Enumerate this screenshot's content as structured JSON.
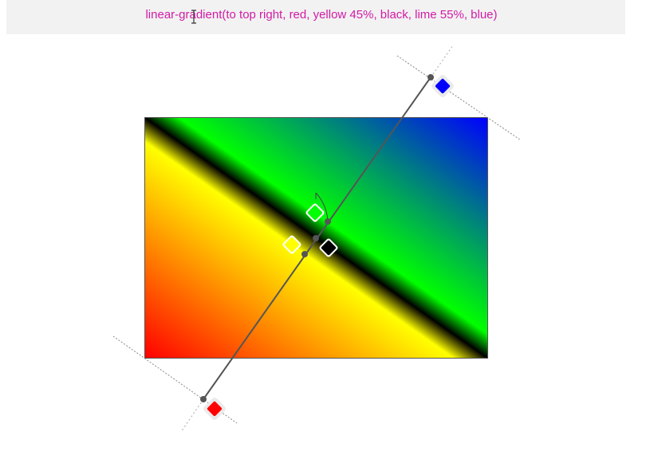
{
  "editor": {
    "css_value": "linear-gradient(to top right, red, yellow 45%, black, lime 55%, blue)"
  },
  "gradient": {
    "direction": "to top right",
    "stops": [
      {
        "color": "#ff0000",
        "name": "red",
        "position": null
      },
      {
        "color": "#ffff00",
        "name": "yellow",
        "position": 45
      },
      {
        "color": "#000000",
        "name": "black",
        "position": null
      },
      {
        "color": "#00ff00",
        "name": "lime",
        "position": 55
      },
      {
        "color": "#0000ff",
        "name": "blue",
        "position": null
      }
    ]
  },
  "colors": {
    "css_text": "#d11ba6",
    "bar_bg": "#f2f2f2",
    "axis_line": "#555555"
  }
}
